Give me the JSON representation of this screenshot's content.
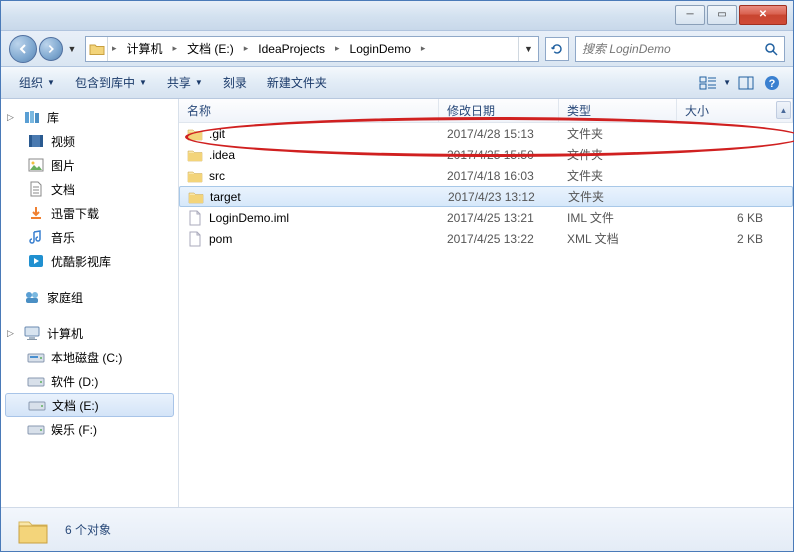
{
  "breadcrumb": {
    "items": [
      "计算机",
      "文档 (E:)",
      "IdeaProjects",
      "LoginDemo"
    ]
  },
  "search": {
    "placeholder": "搜索 LoginDemo"
  },
  "toolbar": {
    "organize": "组织",
    "include": "包含到库中",
    "share": "共享",
    "burn": "刻录",
    "new_folder": "新建文件夹"
  },
  "columns": {
    "name": "名称",
    "date": "修改日期",
    "type": "类型",
    "size": "大小"
  },
  "sidebar": {
    "library": {
      "label": "库"
    },
    "library_items": [
      {
        "label": "视频",
        "icon": "video"
      },
      {
        "label": "图片",
        "icon": "picture"
      },
      {
        "label": "文档",
        "icon": "document"
      },
      {
        "label": "迅雷下载",
        "icon": "download"
      },
      {
        "label": "音乐",
        "icon": "music"
      },
      {
        "label": "优酷影视库",
        "icon": "youku"
      }
    ],
    "homegroup": {
      "label": "家庭组"
    },
    "computer": {
      "label": "计算机"
    },
    "drives": [
      {
        "label": "本地磁盘 (C:)",
        "icon": "drive-c"
      },
      {
        "label": "软件 (D:)",
        "icon": "drive"
      },
      {
        "label": "文档 (E:)",
        "icon": "drive",
        "selected": true
      },
      {
        "label": "娱乐 (F:)",
        "icon": "drive"
      }
    ]
  },
  "files": [
    {
      "name": ".git",
      "date": "2017/4/28 15:13",
      "type": "文件夹",
      "size": "",
      "icon": "folder"
    },
    {
      "name": ".idea",
      "date": "2017/4/25 15:50",
      "type": "文件夹",
      "size": "",
      "icon": "folder"
    },
    {
      "name": "src",
      "date": "2017/4/18 16:03",
      "type": "文件夹",
      "size": "",
      "icon": "folder"
    },
    {
      "name": "target",
      "date": "2017/4/23 13:12",
      "type": "文件夹",
      "size": "",
      "icon": "folder",
      "selected": true
    },
    {
      "name": "LoginDemo.iml",
      "date": "2017/4/25 13:21",
      "type": "IML 文件",
      "size": "6 KB",
      "icon": "file"
    },
    {
      "name": "pom",
      "date": "2017/4/25 13:22",
      "type": "XML 文档",
      "size": "2 KB",
      "icon": "file"
    }
  ],
  "status": {
    "count": "6 个对象"
  }
}
